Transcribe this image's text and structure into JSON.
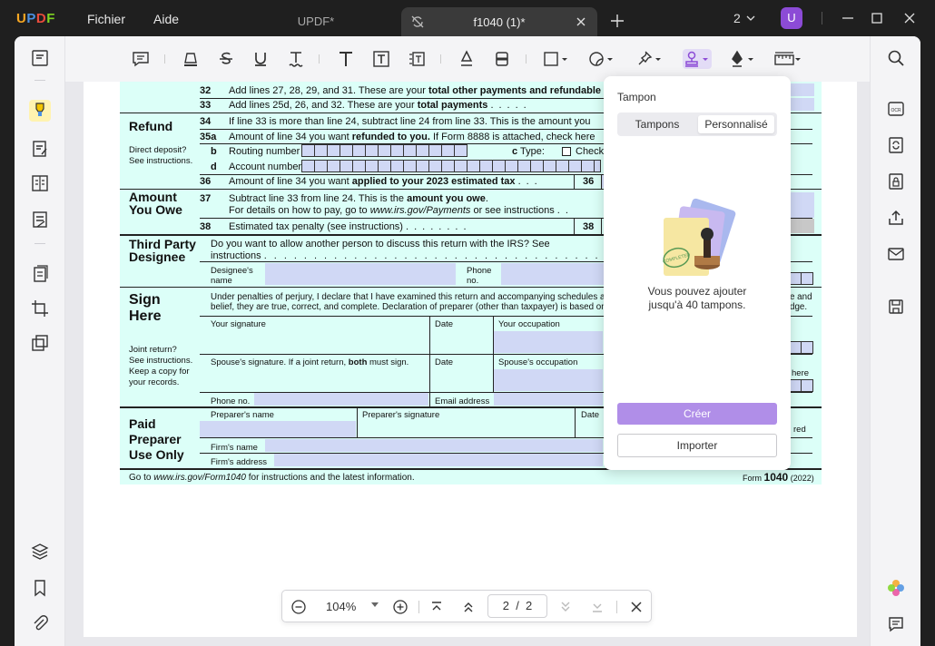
{
  "app": {
    "logo": [
      "U",
      "P",
      "D",
      "F"
    ],
    "menu": [
      "Fichier",
      "Aide"
    ]
  },
  "tabs": [
    {
      "label": "UPDF*",
      "active": false
    },
    {
      "label": "f1040 (1)*",
      "active": true
    }
  ],
  "window_count": "2",
  "user_initial": "U",
  "accent_color": "#8c4bd6",
  "form": {
    "rows": {
      "l32_num": "32",
      "l32_text": "Add lines 27, 28, 29, and 31. These are your",
      "l32_bold": "total other payments and refundable",
      "l33_num": "33",
      "l33_text": "Add lines 25d, 26, and 32. These are your",
      "l33_bold": "total payments",
      "refund": "Refund",
      "l34_num": "34",
      "l34_text": "If line 33 is more than line 24, subtract line 24 from line 33. This is the amount you",
      "l35a_num": "35a",
      "l35a_text": "Amount of line 34 you want",
      "l35a_bold": "refunded to you.",
      "l35a_text2": "If Form 8888 is attached, check here",
      "direct_deposit": "Direct deposit?",
      "see_instructions": "See instructions.",
      "b_label": "b",
      "routing": "Routing number",
      "c_label": "c",
      "type": "Type:",
      "checking": "Check",
      "d_label": "d",
      "account": "Account number",
      "l36_num": "36",
      "l36_text": "Amount of line 34 you want",
      "l36_bold": "applied to your 2023 estimated tax",
      "l36_box": "36",
      "amount_owe_1": "Amount",
      "amount_owe_2": "You Owe",
      "l37_num": "37",
      "l37_text": "Subtract line 33 from line 24. This is the",
      "l37_bold": "amount you owe",
      "l37_text2": "For details on how to pay, go to",
      "l37_url": "www.irs.gov/Payments",
      "l37_text3": "or see instructions",
      "l38_num": "38",
      "l38_text": "Estimated tax penalty (see instructions)",
      "l38_box": "38",
      "third_party_1": "Third Party",
      "third_party_2": "Designee",
      "tp_question": "Do you want to allow another person to discuss this return with the IRS? See",
      "tp_instructions": "instructions",
      "designee_name_1": "Designee's",
      "designee_name_2": "name",
      "phone_1": "Phone",
      "phone_2": "no.",
      "sign_1": "Sign",
      "sign_2": "Here",
      "perjury_1": "Under penalties of perjury, I declare that I have examined this return and accompanying schedules a",
      "perjury_2": "belief, they are true, correct, and complete. Declaration of preparer (other than taxpayer) is based on a",
      "perjury_r1": "e and",
      "perjury_r2": "dge.",
      "your_signature": "Your signature",
      "date": "Date",
      "your_occupation": "Your occupation",
      "joint_1": "Joint return?",
      "joint_2": "See instructions.",
      "joint_3": "Keep a copy for",
      "joint_4": "your records.",
      "spouse_sig": "Spouse's signature. If a joint return,",
      "spouse_both": "both",
      "spouse_sig2": "must sign.",
      "spouse_date": "Date",
      "spouse_occupation": "Spouse's occupation",
      "here_frag": "here",
      "phone_no": "Phone no.",
      "email": "Email address",
      "paid_1": "Paid",
      "paid_2": "Preparer",
      "paid_3": "Use Only",
      "preparer_name": "Preparer's name",
      "preparer_sig": "Preparer's signature",
      "prep_date": "Date",
      "red_frag": "red",
      "firm_name": "Firm's name",
      "firm_address": "Firm's address",
      "footer_goto": "Go to",
      "footer_url": "www.irs.gov/Form1040",
      "footer_rest": "for instructions and the latest information.",
      "footer_form": "Form",
      "footer_1040": "1040",
      "footer_year": "(2022)"
    }
  },
  "stamp_panel": {
    "title": "Tampon",
    "tabs": [
      "Tampons",
      "Personnalisé"
    ],
    "active_tab": "Personnalisé",
    "message": "Vous pouvez ajouter jusqu'à 40 tampons.",
    "stamp_label": "COMPLETED",
    "create_label": "Créer",
    "import_label": "Importer"
  },
  "zoombar": {
    "zoom": "104%",
    "current_page": "2",
    "separator": "/",
    "total_pages": "2"
  }
}
